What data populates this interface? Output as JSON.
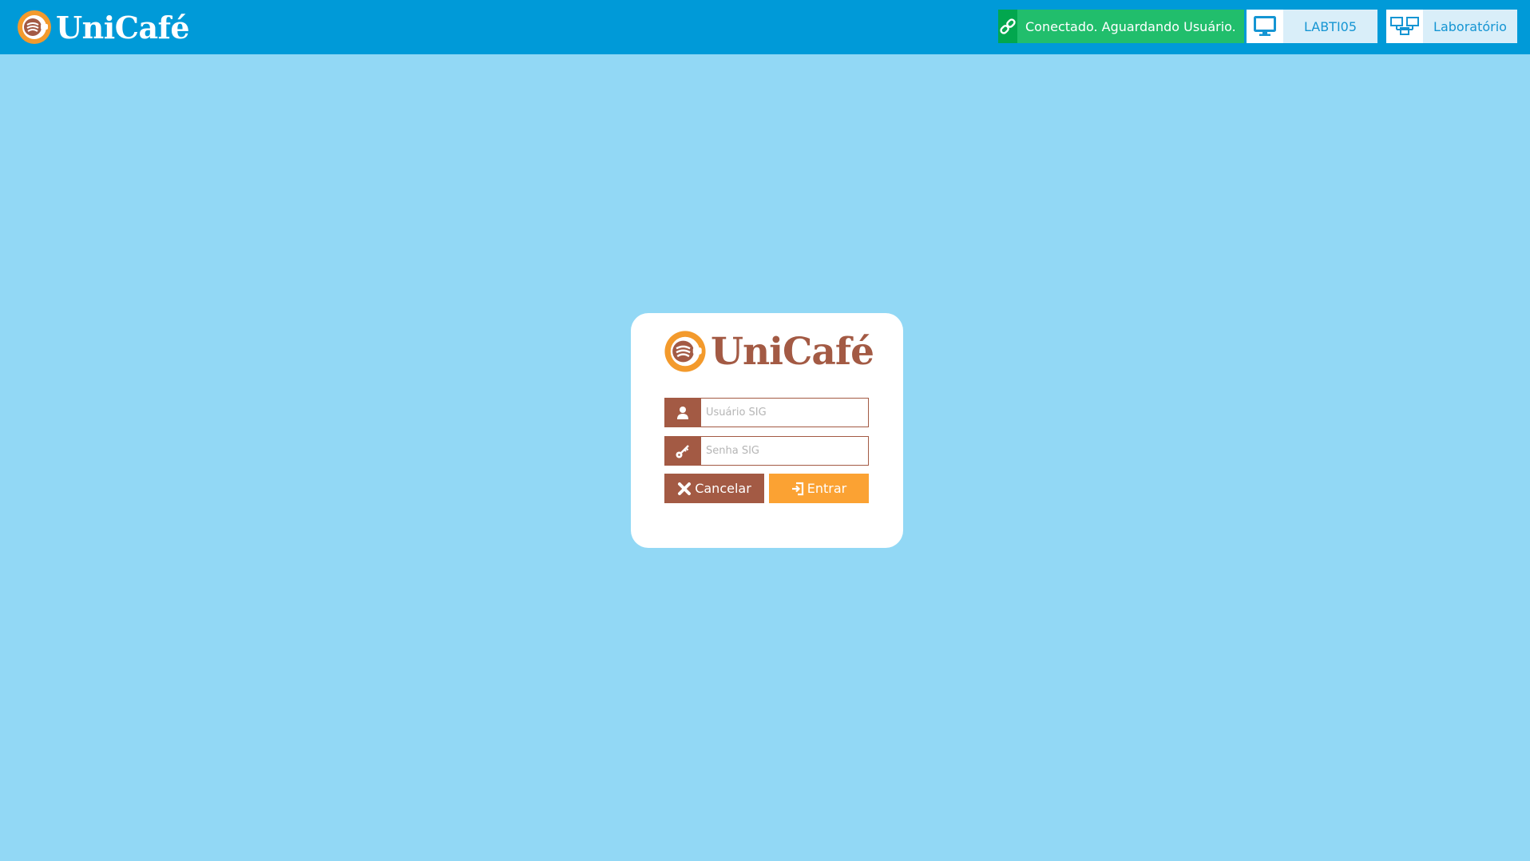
{
  "header": {
    "brand": "UniCafé",
    "status": {
      "connection_text": "Conectado. Aguardando Usuário.",
      "connection_icon": "link-icon",
      "computer_name": "LABTI05",
      "computer_icon": "monitor-icon",
      "lab_name": "Laboratório",
      "lab_icon": "network-computers-icon"
    }
  },
  "login": {
    "brand": "UniCafé",
    "username": {
      "placeholder": "Usuário SIG",
      "value": "",
      "icon": "user-icon"
    },
    "password": {
      "placeholder": "Senha SIG",
      "value": "",
      "icon": "key-icon"
    },
    "cancel_label": "Cancelar",
    "cancel_icon": "close-icon",
    "submit_label": "Entrar",
    "submit_icon": "sign-in-icon"
  },
  "colors": {
    "background": "#92d8f5",
    "topbar": "#009ad8",
    "connected_green": "#21be6c",
    "brand_brown": "#a35a44",
    "brand_orange": "#fba233"
  }
}
